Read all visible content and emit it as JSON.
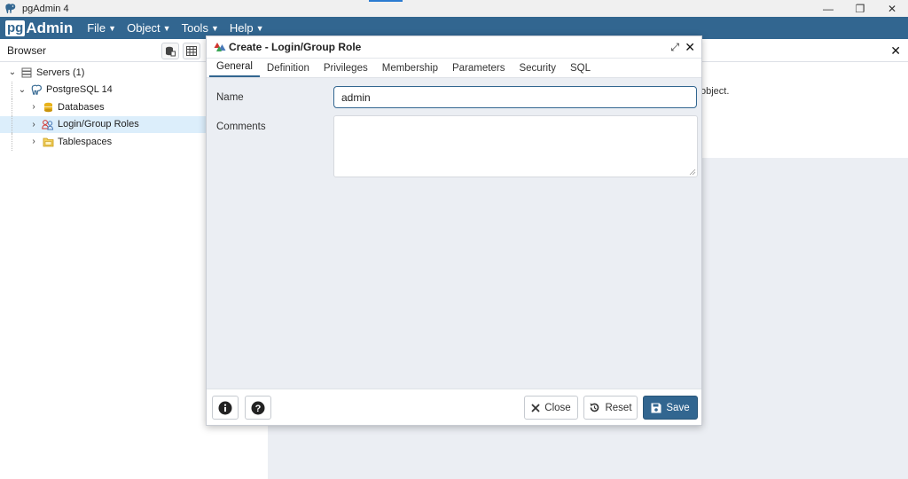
{
  "os": {
    "title": "pgAdmin 4",
    "controls": [
      "—",
      "❐",
      "✕"
    ]
  },
  "menubar": {
    "logo_pg": "pg",
    "logo_admin": "Admin",
    "items": [
      {
        "label": "File"
      },
      {
        "label": "Object"
      },
      {
        "label": "Tools"
      },
      {
        "label": "Help"
      }
    ]
  },
  "browser": {
    "title": "Browser",
    "tree": [
      {
        "label": "Servers (1)",
        "toggle": "⌄",
        "level": 0,
        "icon": "server-group-icon"
      },
      {
        "label": "PostgreSQL 14",
        "toggle": "⌄",
        "level": 1,
        "icon": "postgres-elephant-icon"
      },
      {
        "label": "Databases",
        "toggle": "›",
        "level": 2,
        "icon": "database-icon"
      },
      {
        "label": "Login/Group Roles",
        "toggle": "›",
        "level": 2,
        "icon": "roles-icon",
        "selected": true
      },
      {
        "label": "Tablespaces",
        "toggle": "›",
        "level": 2,
        "icon": "tablespace-icon"
      }
    ]
  },
  "right_panel": {
    "behind_text": "object."
  },
  "dialog": {
    "title": "Create - Login/Group Role",
    "tabs": [
      {
        "label": "General",
        "active": true
      },
      {
        "label": "Definition"
      },
      {
        "label": "Privileges"
      },
      {
        "label": "Membership"
      },
      {
        "label": "Parameters"
      },
      {
        "label": "Security"
      },
      {
        "label": "SQL"
      }
    ],
    "fields": {
      "name_label": "Name",
      "name_value": "admin",
      "comments_label": "Comments",
      "comments_value": ""
    },
    "footer": {
      "close_label": "Close",
      "reset_label": "Reset",
      "save_label": "Save"
    }
  },
  "colors": {
    "brand": "#326690",
    "selected_row": "#dceefb",
    "background": "#ebeef3"
  }
}
